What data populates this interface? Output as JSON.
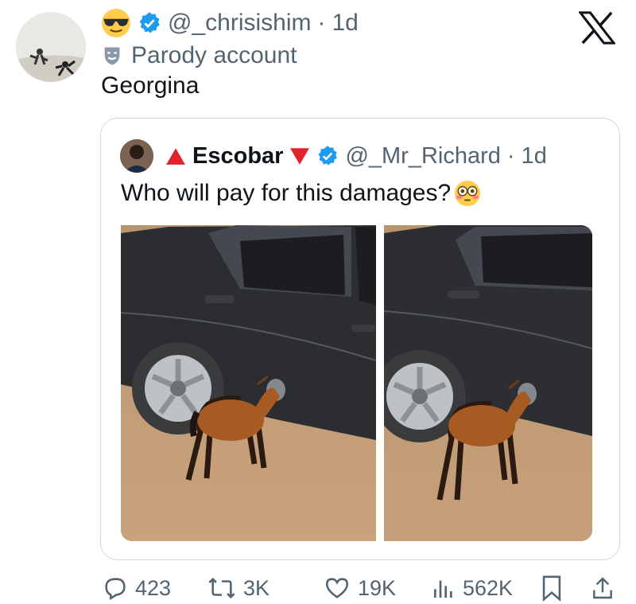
{
  "tweet": {
    "handle": "@_chrisishim",
    "time": "1d",
    "dot": "·",
    "account_label": "Parody account",
    "text": "Georgina"
  },
  "quoted_tweet": {
    "name": "Escobar",
    "handle": "@_Mr_Richard",
    "time": "1d",
    "dot": "·",
    "text": "Who will pay for this damages?"
  },
  "actions": {
    "replies": "423",
    "reposts": "3K",
    "likes": "19K",
    "views": "562K"
  },
  "icons": {
    "header": [
      "sunglasses-emoji-icon",
      "verified-badge-icon",
      "x-logo-icon",
      "parody-mask-icon"
    ],
    "quote": [
      "red-triangle-up-icon",
      "red-triangle-down-icon",
      "verified-badge-icon",
      "flushed-face-emoji-icon"
    ],
    "actions": [
      "reply-icon",
      "repost-icon",
      "like-icon",
      "views-icon",
      "bookmark-icon",
      "share-icon"
    ]
  },
  "colors": {
    "verified": "#1d9bf0",
    "secondary_text": "#536471",
    "primary_text": "#0f1419",
    "red_triangle": "#e0242c"
  }
}
